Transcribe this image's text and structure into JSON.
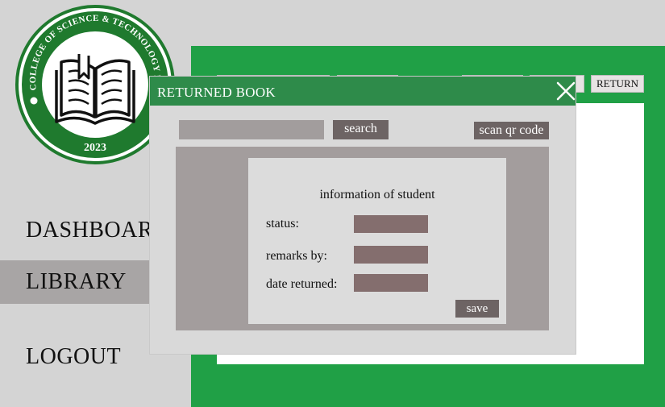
{
  "logo": {
    "ring_text": "COLLEGE OF SCIENCE & TECHNOLOGY INSTITUTE",
    "year": "2023",
    "icon": "open-book-icon"
  },
  "sidebar": {
    "items": [
      {
        "label": "DASHBOARD"
      },
      {
        "label": "LIBRARY"
      },
      {
        "label": "LOGOUT"
      }
    ]
  },
  "tabs": {
    "last_tab_label": "RETURN"
  },
  "modal": {
    "title": "RETURNED BOOK",
    "search_button": "search",
    "scan_button": "scan qr code",
    "info_title": "information of student",
    "fields": [
      {
        "label": "status:"
      },
      {
        "label": "remarks by:"
      },
      {
        "label": "date returned:"
      }
    ],
    "save_button": "save"
  },
  "colors": {
    "green": "#20a046",
    "header_green": "#2e8b4a",
    "button_dark": "#6d6464",
    "field_fill": "#846e6e"
  }
}
